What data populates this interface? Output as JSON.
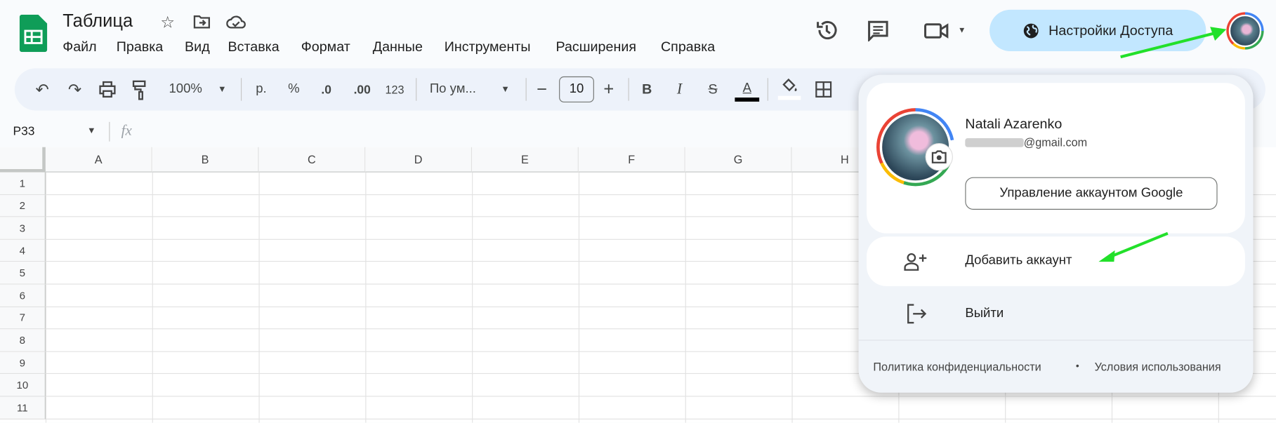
{
  "doc": {
    "title": "Таблица"
  },
  "menu": [
    "Файл",
    "Правка",
    "Вид",
    "Вставка",
    "Формат",
    "Данные",
    "Инструменты",
    "Расширения",
    "Справка"
  ],
  "header": {
    "share_label": "Настройки Доступа"
  },
  "toolbar": {
    "zoom": "100%",
    "currency": "р.",
    "percent": "%",
    "dec_decrease": ".0",
    "dec_increase": ".00",
    "number_format": "123",
    "font": "По ум...",
    "font_size": "10",
    "bold": "B",
    "italic": "I",
    "text_color": "A"
  },
  "formula_bar": {
    "cell_ref": "P33",
    "fx": "fx"
  },
  "grid": {
    "columns": [
      "A",
      "B",
      "C",
      "D",
      "E",
      "F",
      "G",
      "H"
    ],
    "rows": [
      "1",
      "2",
      "3",
      "4",
      "5",
      "6",
      "7",
      "8",
      "9",
      "10",
      "11"
    ]
  },
  "account_popup": {
    "name": "Natali Azarenko",
    "email": "@gmail.com",
    "manage_label": "Управление аккаунтом Google",
    "add_account": "Добавить аккаунт",
    "sign_out": "Выйти",
    "privacy": "Политика конфиденциальности",
    "dot": "•",
    "terms": "Условия использования"
  },
  "colors": {
    "accent": "#c2e7ff",
    "sheets_green": "#0f9d58",
    "annotation_arrow": "#22e02a"
  }
}
